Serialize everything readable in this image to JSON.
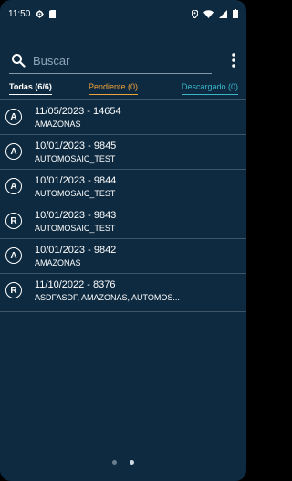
{
  "status_bar": {
    "time": "11:50",
    "icons": [
      "settings-icon",
      "sim-card-icon",
      "location-icon",
      "wifi-icon",
      "signal-icon",
      "battery-icon"
    ]
  },
  "search": {
    "placeholder": "Buscar",
    "icon": "search-icon",
    "menu_icon": "more-vert-icon"
  },
  "tabs": [
    {
      "label": "Todas (6/6)",
      "color": "#ffffff",
      "active": true
    },
    {
      "label": "Pendiente (0)",
      "color": "#f0a237"
    },
    {
      "label": "Descargado (0)",
      "color": "#3ab6c8"
    }
  ],
  "items": [
    {
      "badge": "A",
      "title": "11/05/2023 - 14654",
      "subtitle": "AMAZONAS"
    },
    {
      "badge": "A",
      "title": "10/01/2023 - 9845",
      "subtitle": "AUTOMOSAIC_TEST"
    },
    {
      "badge": "A",
      "title": "10/01/2023 - 9844",
      "subtitle": "AUTOMOSAIC_TEST"
    },
    {
      "badge": "R",
      "title": "10/01/2023 - 9843",
      "subtitle": "AUTOMOSAIC_TEST"
    },
    {
      "badge": "A",
      "title": "10/01/2023 - 9842",
      "subtitle": "AMAZONAS"
    },
    {
      "badge": "R",
      "title": "11/10/2022 - 8376",
      "subtitle": "ASDFASDF, AMAZONAS, AUTOMOS..."
    }
  ],
  "pager": {
    "pages": 2,
    "current": 2
  },
  "colors": {
    "background": "#0e2a40",
    "divider": "#3e5568",
    "pending": "#f0a237",
    "downloaded": "#3ab6c8"
  }
}
